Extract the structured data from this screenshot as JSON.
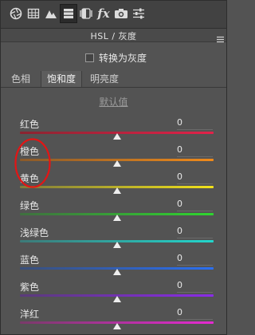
{
  "toolbar": {
    "icons": [
      "aperture-icon",
      "grid-icon",
      "mountain-icon",
      "hsl-icon",
      "split-toning-icon",
      "fx-icon",
      "camera-icon",
      "sliders-icon"
    ],
    "fx_label": "fx"
  },
  "panel": {
    "title": "HSL / 灰度",
    "grayscale_label": "转换为灰度",
    "grayscale_checked": false,
    "tabs": [
      {
        "label": "色相",
        "active": false
      },
      {
        "label": "饱和度",
        "active": true
      },
      {
        "label": "明亮度",
        "active": false
      }
    ],
    "default_label": "默认值"
  },
  "sliders": [
    {
      "label": "红色",
      "value": "0",
      "colors": [
        "#8a2430",
        "#e2224a"
      ]
    },
    {
      "label": "橙色",
      "value": "0",
      "colors": [
        "#8a5a2a",
        "#f08a1a"
      ]
    },
    {
      "label": "黄色",
      "value": "0",
      "colors": [
        "#7f7b3a",
        "#f2e21a"
      ]
    },
    {
      "label": "绿色",
      "value": "0",
      "colors": [
        "#3f6f3f",
        "#2fd62f"
      ]
    },
    {
      "label": "浅绿色",
      "value": "0",
      "colors": [
        "#3d7a78",
        "#22d6cc"
      ]
    },
    {
      "label": "蓝色",
      "value": "0",
      "colors": [
        "#3a4f7a",
        "#2b6ff0"
      ]
    },
    {
      "label": "紫色",
      "value": "0",
      "colors": [
        "#5a3a7a",
        "#8a2be8"
      ]
    },
    {
      "label": "洋红",
      "value": "0",
      "colors": [
        "#7a3a6a",
        "#e52ad2"
      ]
    }
  ],
  "colors": {
    "annotation": "#e31515",
    "thumb": "#eeeeee"
  }
}
